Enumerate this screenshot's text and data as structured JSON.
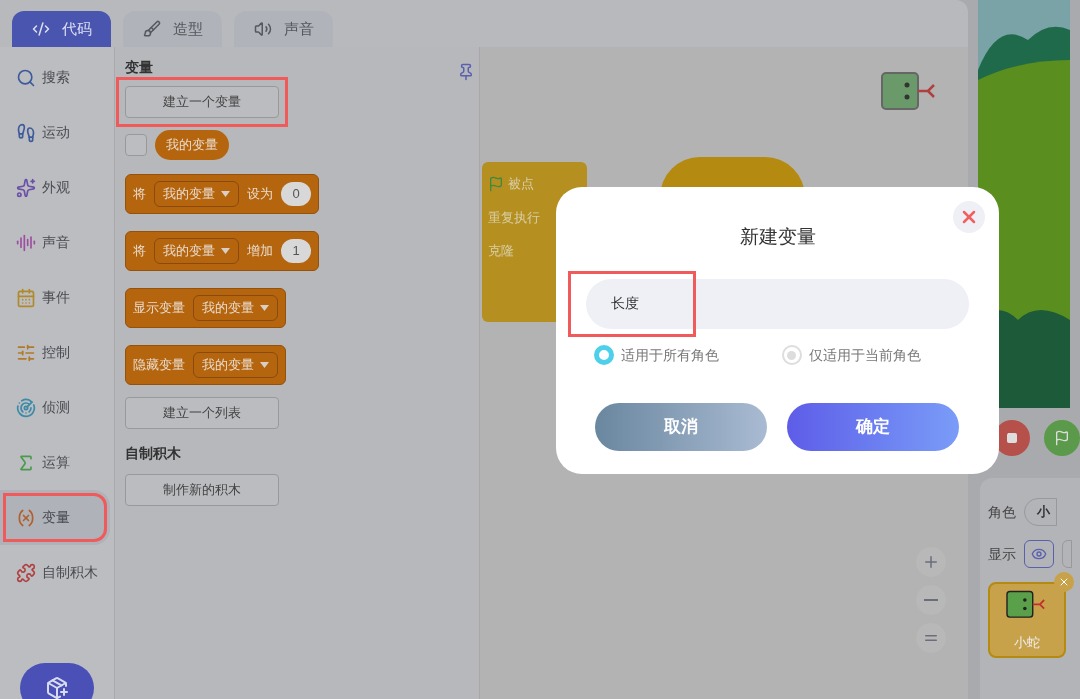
{
  "tabs": [
    {
      "label": "代码",
      "selected": true
    },
    {
      "label": "造型",
      "selected": false
    },
    {
      "label": "声音",
      "selected": false
    }
  ],
  "categories": [
    {
      "label": "搜索",
      "selected": false,
      "highlighted": false
    },
    {
      "label": "运动",
      "selected": false,
      "highlighted": false
    },
    {
      "label": "外观",
      "selected": false,
      "highlighted": false
    },
    {
      "label": "声音",
      "selected": false,
      "highlighted": false
    },
    {
      "label": "事件",
      "selected": false,
      "highlighted": false
    },
    {
      "label": "控制",
      "selected": false,
      "highlighted": false
    },
    {
      "label": "侦测",
      "selected": false,
      "highlighted": false
    },
    {
      "label": "运算",
      "selected": false,
      "highlighted": false
    },
    {
      "label": "变量",
      "selected": true,
      "highlighted": true
    },
    {
      "label": "自制积木",
      "selected": false,
      "highlighted": false
    }
  ],
  "palette": {
    "title": "变量",
    "make_variable": {
      "label": "建立一个变量",
      "highlighted": true
    },
    "variable": {
      "label": "我的变量",
      "checked": false
    },
    "blocks": [
      {
        "parts": [
          {
            "kind": "text",
            "text": "将"
          },
          {
            "kind": "dropdown",
            "text": "我的变量"
          },
          {
            "kind": "text",
            "text": "设为"
          },
          {
            "kind": "number",
            "text": "0"
          }
        ]
      },
      {
        "parts": [
          {
            "kind": "text",
            "text": "将"
          },
          {
            "kind": "dropdown",
            "text": "我的变量"
          },
          {
            "kind": "text",
            "text": "增加"
          },
          {
            "kind": "number",
            "text": "1"
          }
        ]
      },
      {
        "parts": [
          {
            "kind": "text",
            "text": "显示变量"
          },
          {
            "kind": "dropdown",
            "text": "我的变量"
          }
        ]
      },
      {
        "parts": [
          {
            "kind": "text",
            "text": "隐藏变量"
          },
          {
            "kind": "dropdown",
            "text": "我的变量"
          }
        ]
      }
    ],
    "make_list": "建立一个列表",
    "custom_title": "自制积木",
    "make_block": "制作新的积木"
  },
  "canvas": {
    "script": [
      "被点",
      "重复执行",
      "克隆"
    ]
  },
  "sprite_panel": {
    "sprite_label": "角色",
    "sprite_name": "小",
    "show_label": "显示",
    "sprites": [
      {
        "name": "小蛇",
        "selected": true
      }
    ]
  },
  "dialog": {
    "title": "新建变量",
    "input": {
      "value": "长度",
      "highlighted": true
    },
    "options": [
      {
        "label": "适用于所有角色",
        "selected": true
      },
      {
        "label": "仅适用于当前角色",
        "selected": false
      }
    ],
    "cancel": "取消",
    "confirm": "确定"
  }
}
